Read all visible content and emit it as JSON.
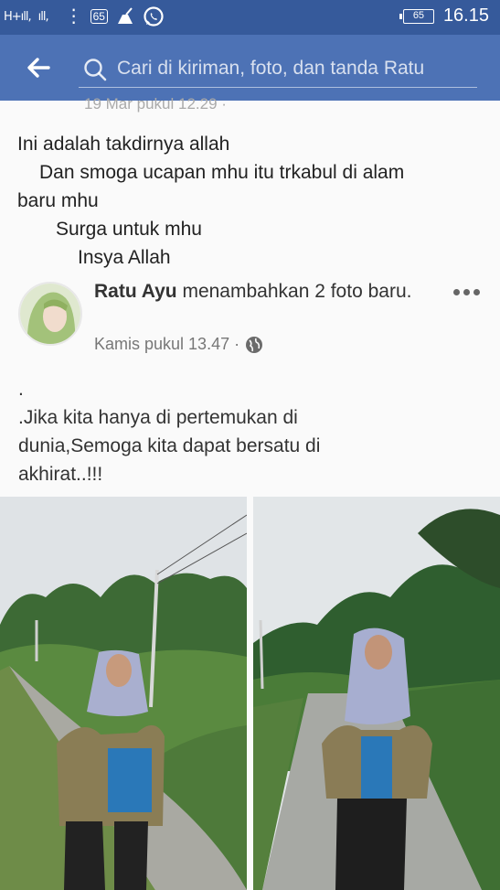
{
  "status_bar": {
    "signal_1": "H+",
    "signal_2": "H",
    "msg_badge": "65",
    "battery": "65",
    "time": "16.15"
  },
  "app_bar": {
    "back_icon": "arrow-left-icon",
    "search_placeholder": "Cari di kiriman, foto, dan tanda Ratu"
  },
  "post": {
    "ghost_date": "19 Mar pukul 12.29 · ",
    "message_lines": [
      "Ini adalah takdirnya allah",
      "      Dan smoga ucapan mhu itu trkabul di alam",
      "baru mhu",
      "      Surga untuk mhu",
      "         Insya Allah"
    ],
    "shared": {
      "author": "Ratu Ayu",
      "action": " menambahkan 2 foto baru.",
      "timestamp": "Kamis pukul 13.47 ·",
      "caption_lines": [
        ".",
        ".Jika kita hanya di pertemukan di",
        "dunia,Semoga kita dapat bersatu di",
        "akhirat..!!!"
      ]
    }
  },
  "colors": {
    "status_bar": "#365a9b",
    "app_bar": "#4d72b5"
  }
}
